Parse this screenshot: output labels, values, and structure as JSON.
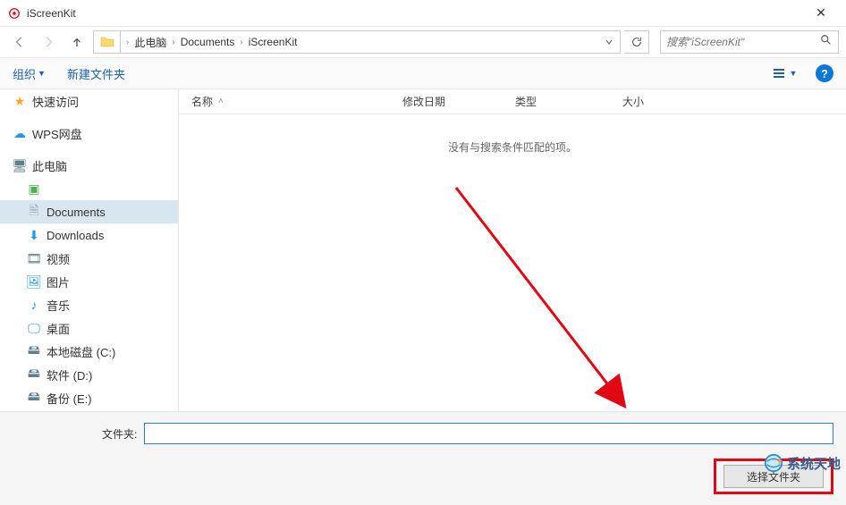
{
  "window": {
    "title": "iScreenKit"
  },
  "breadcrumb": {
    "seg0": "此电脑",
    "seg1": "Documents",
    "seg2": "iScreenKit"
  },
  "search": {
    "placeholder": "搜索\"iScreenKit\""
  },
  "toolbar": {
    "organize": "组织",
    "new_folder": "新建文件夹"
  },
  "columns": {
    "name": "名称",
    "date": "修改日期",
    "type": "类型",
    "size": "大小"
  },
  "filelist": {
    "empty": "没有与搜索条件匹配的项。"
  },
  "sidebar": {
    "quick": "快速访问",
    "wps": "WPS网盘",
    "pc": "此电脑",
    "green": "",
    "documents": "Documents",
    "downloads": "Downloads",
    "video": "视频",
    "pictures": "图片",
    "music": "音乐",
    "desktop": "桌面",
    "diskc": "本地磁盘 (C:)",
    "diskd": "软件 (D:)",
    "diske": "备份 (E:)"
  },
  "bottom": {
    "folder_label": "文件夹:",
    "folder_value": "",
    "select_button": "选择文件夹"
  },
  "watermark": {
    "text": "系统天地"
  }
}
